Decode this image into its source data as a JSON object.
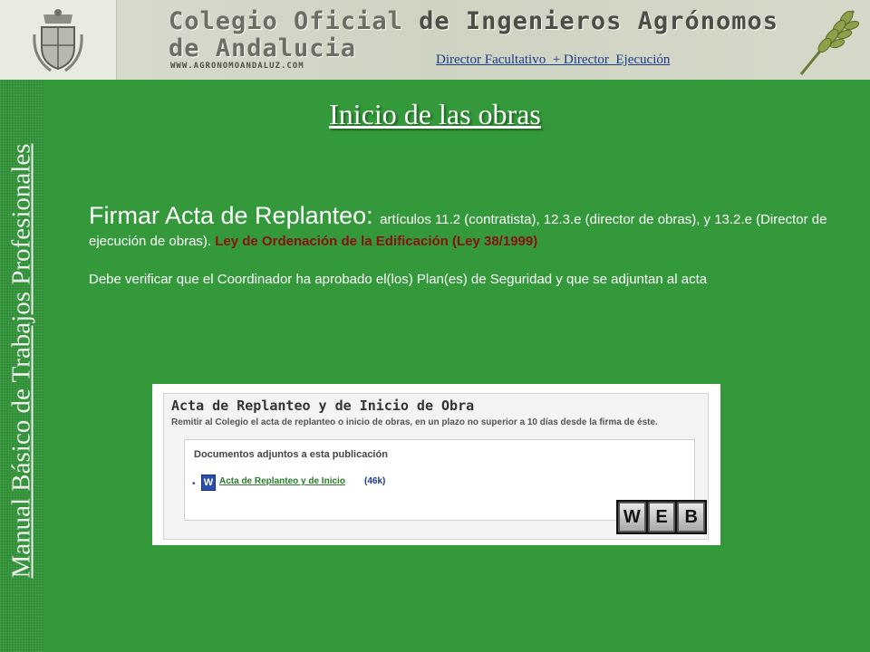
{
  "header": {
    "title_line1_a": "Colegio Oficial",
    "title_line1_b": "de Ingenieros Agrónomos",
    "title_line2": "de Andalucia",
    "url": "WWW.AGRONOMOANDALUZ.COM",
    "link": "Director Facultativo  + Director  Ejecución"
  },
  "sidebar": {
    "text": "Manual Básico de Trabajos Profesionales"
  },
  "main": {
    "title": "Inicio  de las obras",
    "para1_big": "Firmar Acta de Replanteo: ",
    "para1_small": "artículos 11.2 (contratista), 12.3.e (director de obras), y 13.2.e (Director de ejecución de obras). ",
    "para1_law": "Ley de Ordenación de la Edificación (Ley 38/1999)",
    "para2": "Debe verificar que el Coordinador ha aprobado el(los) Plan(es) de Seguridad y que se adjuntan al acta"
  },
  "screenshot": {
    "title": "Acta de Replanteo y de Inicio de Obra",
    "description": "Remitir al Colegio el acta de replanteo o inicio de obras, en un plazo no superior a 10 días desde la firma de éste.",
    "box_label": "Documentos adjuntos a esta publicación",
    "bullet": "•",
    "icon_letter": "W",
    "link": "Acta de Replanteo y de Inicio",
    "size": "(46k)"
  },
  "web_keys": [
    "W",
    "E",
    "B"
  ],
  "colors": {
    "background": "#33993a",
    "law_text": "#8a1010",
    "header_link": "#1a3a8a"
  }
}
